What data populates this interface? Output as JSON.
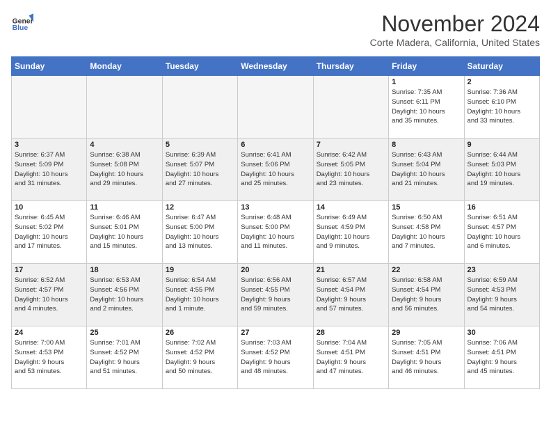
{
  "header": {
    "logo_line1": "General",
    "logo_line2": "Blue",
    "title": "November 2024",
    "subtitle": "Corte Madera, California, United States"
  },
  "weekdays": [
    "Sunday",
    "Monday",
    "Tuesday",
    "Wednesday",
    "Thursday",
    "Friday",
    "Saturday"
  ],
  "weeks": [
    [
      {
        "day": "",
        "info": ""
      },
      {
        "day": "",
        "info": ""
      },
      {
        "day": "",
        "info": ""
      },
      {
        "day": "",
        "info": ""
      },
      {
        "day": "",
        "info": ""
      },
      {
        "day": "1",
        "info": "Sunrise: 7:35 AM\nSunset: 6:11 PM\nDaylight: 10 hours\nand 35 minutes."
      },
      {
        "day": "2",
        "info": "Sunrise: 7:36 AM\nSunset: 6:10 PM\nDaylight: 10 hours\nand 33 minutes."
      }
    ],
    [
      {
        "day": "3",
        "info": "Sunrise: 6:37 AM\nSunset: 5:09 PM\nDaylight: 10 hours\nand 31 minutes."
      },
      {
        "day": "4",
        "info": "Sunrise: 6:38 AM\nSunset: 5:08 PM\nDaylight: 10 hours\nand 29 minutes."
      },
      {
        "day": "5",
        "info": "Sunrise: 6:39 AM\nSunset: 5:07 PM\nDaylight: 10 hours\nand 27 minutes."
      },
      {
        "day": "6",
        "info": "Sunrise: 6:41 AM\nSunset: 5:06 PM\nDaylight: 10 hours\nand 25 minutes."
      },
      {
        "day": "7",
        "info": "Sunrise: 6:42 AM\nSunset: 5:05 PM\nDaylight: 10 hours\nand 23 minutes."
      },
      {
        "day": "8",
        "info": "Sunrise: 6:43 AM\nSunset: 5:04 PM\nDaylight: 10 hours\nand 21 minutes."
      },
      {
        "day": "9",
        "info": "Sunrise: 6:44 AM\nSunset: 5:03 PM\nDaylight: 10 hours\nand 19 minutes."
      }
    ],
    [
      {
        "day": "10",
        "info": "Sunrise: 6:45 AM\nSunset: 5:02 PM\nDaylight: 10 hours\nand 17 minutes."
      },
      {
        "day": "11",
        "info": "Sunrise: 6:46 AM\nSunset: 5:01 PM\nDaylight: 10 hours\nand 15 minutes."
      },
      {
        "day": "12",
        "info": "Sunrise: 6:47 AM\nSunset: 5:00 PM\nDaylight: 10 hours\nand 13 minutes."
      },
      {
        "day": "13",
        "info": "Sunrise: 6:48 AM\nSunset: 5:00 PM\nDaylight: 10 hours\nand 11 minutes."
      },
      {
        "day": "14",
        "info": "Sunrise: 6:49 AM\nSunset: 4:59 PM\nDaylight: 10 hours\nand 9 minutes."
      },
      {
        "day": "15",
        "info": "Sunrise: 6:50 AM\nSunset: 4:58 PM\nDaylight: 10 hours\nand 7 minutes."
      },
      {
        "day": "16",
        "info": "Sunrise: 6:51 AM\nSunset: 4:57 PM\nDaylight: 10 hours\nand 6 minutes."
      }
    ],
    [
      {
        "day": "17",
        "info": "Sunrise: 6:52 AM\nSunset: 4:57 PM\nDaylight: 10 hours\nand 4 minutes."
      },
      {
        "day": "18",
        "info": "Sunrise: 6:53 AM\nSunset: 4:56 PM\nDaylight: 10 hours\nand 2 minutes."
      },
      {
        "day": "19",
        "info": "Sunrise: 6:54 AM\nSunset: 4:55 PM\nDaylight: 10 hours\nand 1 minute."
      },
      {
        "day": "20",
        "info": "Sunrise: 6:56 AM\nSunset: 4:55 PM\nDaylight: 9 hours\nand 59 minutes."
      },
      {
        "day": "21",
        "info": "Sunrise: 6:57 AM\nSunset: 4:54 PM\nDaylight: 9 hours\nand 57 minutes."
      },
      {
        "day": "22",
        "info": "Sunrise: 6:58 AM\nSunset: 4:54 PM\nDaylight: 9 hours\nand 56 minutes."
      },
      {
        "day": "23",
        "info": "Sunrise: 6:59 AM\nSunset: 4:53 PM\nDaylight: 9 hours\nand 54 minutes."
      }
    ],
    [
      {
        "day": "24",
        "info": "Sunrise: 7:00 AM\nSunset: 4:53 PM\nDaylight: 9 hours\nand 53 minutes."
      },
      {
        "day": "25",
        "info": "Sunrise: 7:01 AM\nSunset: 4:52 PM\nDaylight: 9 hours\nand 51 minutes."
      },
      {
        "day": "26",
        "info": "Sunrise: 7:02 AM\nSunset: 4:52 PM\nDaylight: 9 hours\nand 50 minutes."
      },
      {
        "day": "27",
        "info": "Sunrise: 7:03 AM\nSunset: 4:52 PM\nDaylight: 9 hours\nand 48 minutes."
      },
      {
        "day": "28",
        "info": "Sunrise: 7:04 AM\nSunset: 4:51 PM\nDaylight: 9 hours\nand 47 minutes."
      },
      {
        "day": "29",
        "info": "Sunrise: 7:05 AM\nSunset: 4:51 PM\nDaylight: 9 hours\nand 46 minutes."
      },
      {
        "day": "30",
        "info": "Sunrise: 7:06 AM\nSunset: 4:51 PM\nDaylight: 9 hours\nand 45 minutes."
      }
    ]
  ]
}
